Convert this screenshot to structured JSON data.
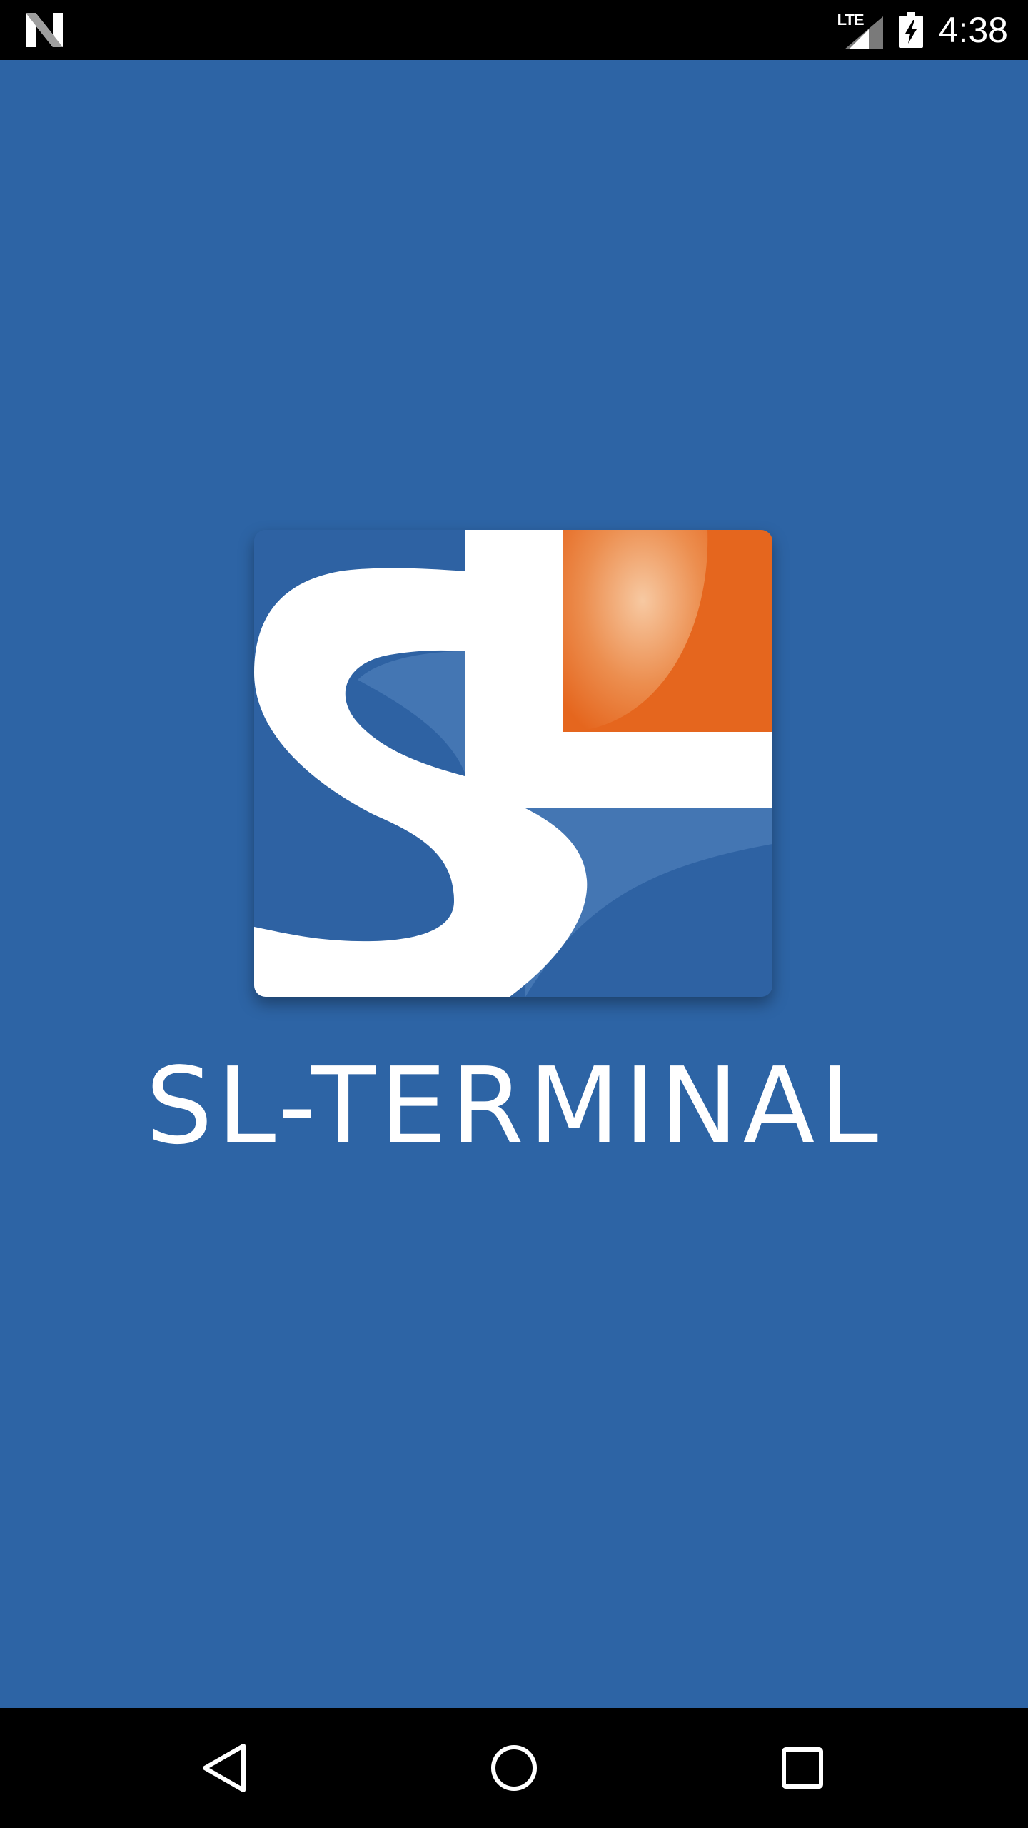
{
  "status_bar": {
    "network_type": "LTE",
    "time": "4:38",
    "icons": [
      "notification-n-icon",
      "signal-icon",
      "battery-charging-icon"
    ]
  },
  "splash": {
    "background_color": "#2d64a5",
    "logo_icon": "sl-logo",
    "logo_accent_color": "#e5661e",
    "app_title": "SL-TERMINAL"
  },
  "nav_bar": {
    "icons": [
      "back-icon",
      "home-icon",
      "recents-icon"
    ]
  }
}
